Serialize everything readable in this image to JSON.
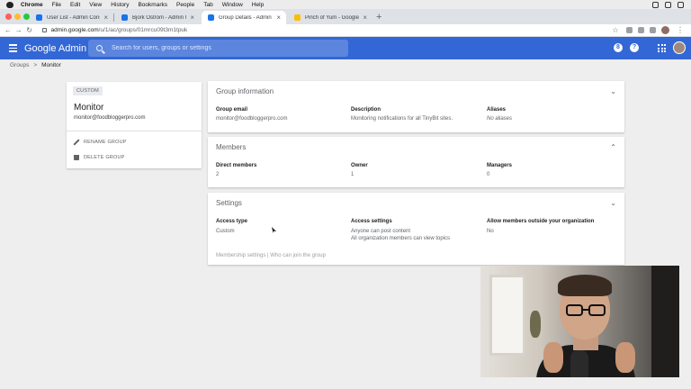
{
  "macos_menu": {
    "app": "Chrome",
    "items": [
      "File",
      "Edit",
      "View",
      "History",
      "Bookmarks",
      "People",
      "Tab",
      "Window",
      "Help"
    ]
  },
  "browser": {
    "tabs": [
      {
        "title": "User List - Admin Console",
        "close": "×",
        "favicon_color": "#1a73e8",
        "active": false
      },
      {
        "title": "Bjork Ostrom - Admin Console",
        "close": "×",
        "favicon_color": "#1a73e8",
        "active": false
      },
      {
        "title": "Group Details - Admin Console",
        "close": "×",
        "favicon_color": "#1a73e8",
        "active": true
      },
      {
        "title": "Pinch of Yum - Google Drive",
        "close": "×",
        "favicon_color": "#fbbc04",
        "active": false
      }
    ],
    "new_tab": "+",
    "nav": {
      "back": "←",
      "forward": "→",
      "reload": "↻"
    },
    "url_host": "admin.google.com",
    "url_path": "/u/1/ac/groups/01mrcu09t3m1tpuk",
    "bookmark": "☆"
  },
  "header": {
    "brand": "Google Admin",
    "search_placeholder": "Search for users, groups or settings",
    "help_badge": "?",
    "account_badge": "8",
    "accent": "#3367d6"
  },
  "breadcrumb": {
    "parent": "Groups",
    "separator": ">",
    "current": "Monitor"
  },
  "group_card": {
    "chip": "CUSTOM",
    "name": "Monitor",
    "email": "monitor@foodbloggerpro.com",
    "actions": [
      {
        "label": "RENAME GROUP",
        "icon": "pencil-icon"
      },
      {
        "label": "DELETE GROUP",
        "icon": "trash-icon"
      }
    ]
  },
  "group_information": {
    "title": "Group information",
    "chevron": "⌄",
    "email_label": "Group email",
    "email_value": "monitor@foodbloggerpro.com",
    "description_label": "Description",
    "description_value": "Monitoring notifications for all TinyBit sites.",
    "aliases_label": "Aliases",
    "aliases_value": "No aliases"
  },
  "members": {
    "title": "Members",
    "chevron": "⌃",
    "direct_label": "Direct members",
    "direct_value": "2",
    "owner_label": "Owner",
    "owner_value": "1",
    "managers_label": "Managers",
    "managers_value": "0"
  },
  "settings": {
    "title": "Settings",
    "chevron": "⌄",
    "access_type_label": "Access type",
    "access_type_value": "Custom",
    "access_settings_label": "Access settings",
    "access_settings_line1": "Anyone can post content",
    "access_settings_line2": "All organization members can view topics",
    "outside_label": "Allow members outside your organization",
    "outside_value": "No",
    "footer": "Membership settings | Who can join the group"
  }
}
